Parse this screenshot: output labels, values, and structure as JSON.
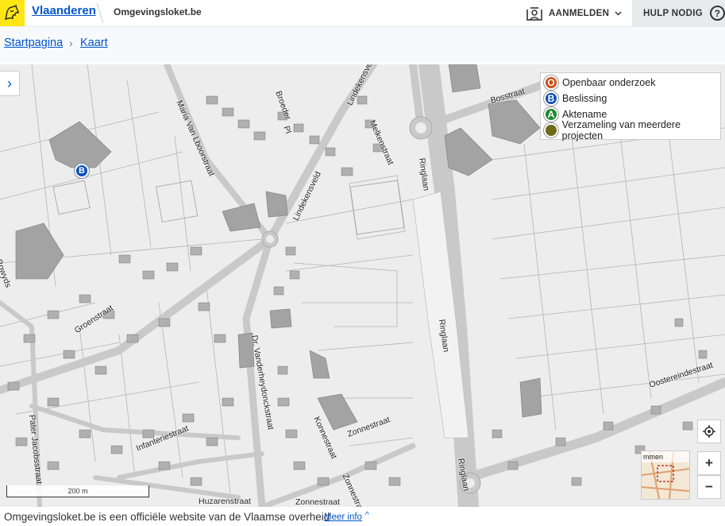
{
  "header": {
    "brand": "Vlaanderen",
    "site": "Omgevingsloket.be",
    "login_label": "AANMELDEN",
    "help_label": "HULP NODIG",
    "help_glyph": "?"
  },
  "breadcrumb": {
    "home": "Startpagina",
    "separator": "›",
    "current": "Kaart"
  },
  "legend": {
    "items": [
      {
        "letter": "O",
        "label": "Openbaar onderzoek",
        "color": "#d04a0c"
      },
      {
        "letter": "B",
        "label": "Beslissing",
        "color": "#0a4fb8"
      },
      {
        "letter": "A",
        "label": "Aktename",
        "color": "#1b8a2c"
      },
      {
        "letter": "",
        "label": "Verzameling van meerdere projecten",
        "color": "#6f6a19"
      }
    ]
  },
  "map": {
    "marker_letter": "B",
    "scale_label": "200 m",
    "overview_label": "mmen",
    "zoom_in": "+",
    "zoom_out": "−",
    "expand_glyph": "›",
    "streets": {
      "maria": "Maria Van Lboorstraat",
      "broederstraat": "Broeder",
      "lindekens1": "Lindekensveld",
      "lindekens2": "Lindekensveld",
      "melken": "Melkenstraat",
      "bosstraat": "Bosstraat",
      "ringlaan1": "Ringlaan",
      "ringlaan2": "Ringlaan",
      "ringlaan3": "Ringlaan",
      "groenstraat": "Groenstraat",
      "vanderhey": "Dr. Vanderheydonckstraat",
      "konnestraat": "Konnestraat",
      "zonnestraat1": "Zonnestraat",
      "zonnestraat2": "Zonnestraat",
      "zonnestraat3": "Zonnestraat",
      "infanterie": "Infanteriestraat",
      "huzaren": "Huzarenstraat",
      "pater": "Pater Jacobsstraat",
      "oostereinde": "Oostereindestraat",
      "bowyer": "Bowyds",
      "pl": "Pl"
    }
  },
  "footer": {
    "text": "Omgevingsloket.be is een officiële website van de Vlaamse overheid",
    "more": "Meer info",
    "chevron": "^"
  },
  "colors": {
    "link": "#0055cc",
    "logo_bg": "#ffe615",
    "map_bg": "#ededed",
    "road": "#bdbdbd",
    "building": "#9a9a9a"
  }
}
